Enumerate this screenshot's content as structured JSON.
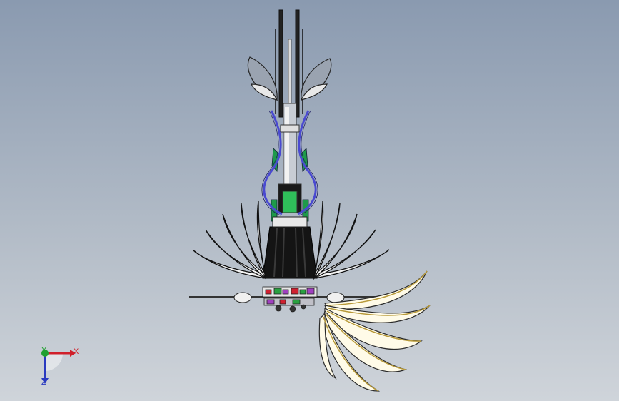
{
  "viewport": {
    "background_top": "#8a9ab0",
    "background_bottom": "#cfd4da"
  },
  "model": {
    "icon": "mechanical-bird-model",
    "colors": {
      "blue_arms": "#4a4ad0",
      "green_parts": "#1e9a4a",
      "black_body": "#141414",
      "wing_fill": "#fffbe8",
      "wing_stroke": "#2a2a2a",
      "gold_edge": "#b89a3a"
    }
  },
  "triad": {
    "x_label": "X",
    "y_label": "Y",
    "z_label": "Z",
    "x_color": "#d0202a",
    "y_color": "#20a030",
    "z_color": "#2a3ac0"
  }
}
